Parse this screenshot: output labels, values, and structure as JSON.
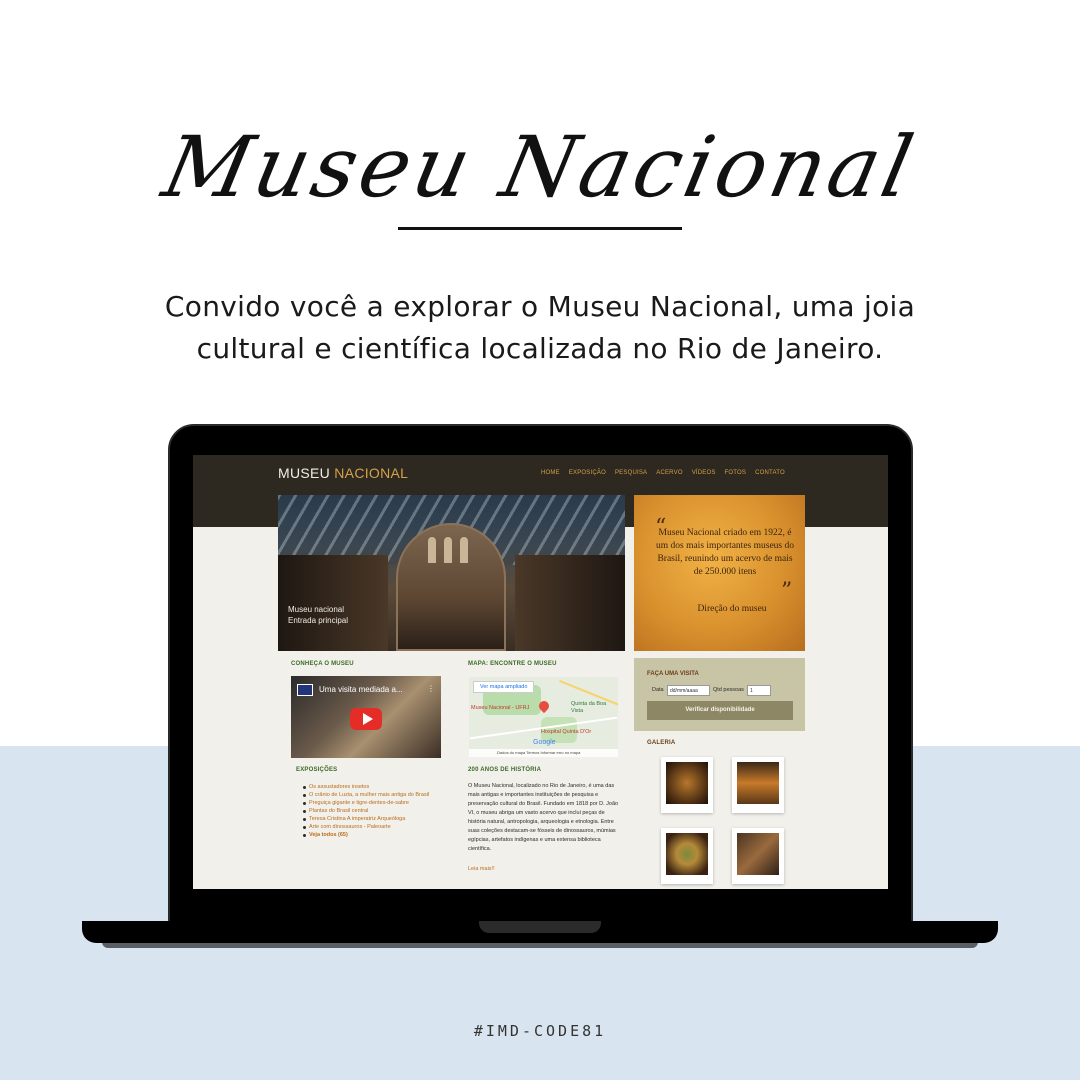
{
  "title": "Museu Nacional",
  "intro": "Convido você a explorar o Museu Nacional, uma joia cultural e científica localizada no Rio de Janeiro.",
  "hashtag": "#IMD-CODE81",
  "site": {
    "logo_main": "MUSEU",
    "logo_accent": "NACIONAL",
    "nav": [
      "HOME",
      "EXPOSIÇÃO",
      "PESQUISA",
      "ACERVO",
      "VÍDEOS",
      "FOTOS",
      "CONTATO"
    ],
    "hero_caption_line1": "Museu nacional",
    "hero_caption_line2": "Entrada principal",
    "quote_text": "Museu Nacional criado em 1922, é um dos mais importantes museus do Brasil, reunindo um acervo de mais de 250.000 itens",
    "quote_author": "Direção do museu",
    "section_conheca": "CONHEÇA O MUSEU",
    "video_title": "Uma visita mediada a...",
    "section_mapa": "MAPA: ENCONTRE O MUSEU",
    "map_button": "Ver mapa ampliado",
    "map_label_museu": "Museu Nacional - UFRJ",
    "map_label_quinta": "Quinta da Boa Vista",
    "map_label_hospital": "Hospital Quinta D'Or",
    "map_footer": "Dados do mapa   Termos   Informar erro no mapa",
    "map_google": "Google",
    "section_visita": "FAÇA UMA VISITA",
    "visit_date_label": "Data",
    "visit_date_placeholder": "dd/mm/aaaa",
    "visit_qty_label": "Qtd pessoas",
    "visit_qty_value": "1",
    "visit_button": "Verificar disponibilidade",
    "section_exposicoes": "EXPOSIÇÕES",
    "exhibitions": [
      "Os assustadores insetos",
      "O crânio de Luzia, a mulher mais antiga do Brasil",
      "Preguiça gigante e tigre-dentes-de-sabre",
      "Plantas do Brasil central",
      "Teresa Cristina  A imperatriz Arqueóloga",
      "Arte com dinossauros - Paleoarte",
      "Veja todos (65)"
    ],
    "section_historia": "200 ANOS DE HISTÓRIA",
    "history_text": "O Museu Nacional, localizado no Rio de Janeiro, é uma das mais antigas e importantes instituições de pesquisa e preservação cultural do Brasil. Fundado em 1818 por D. João VI, o museu abriga um vasto acervo que inclui peças de história natural, antropologia, arqueologia e etnologia. Entre suas coleções destacam-se fósseis de dinossauros, múmias egípcias, artefatos indígenas e uma extensa biblioteca científica.",
    "history_link": "Leia mais!!",
    "section_galeria": "GALERIA"
  }
}
